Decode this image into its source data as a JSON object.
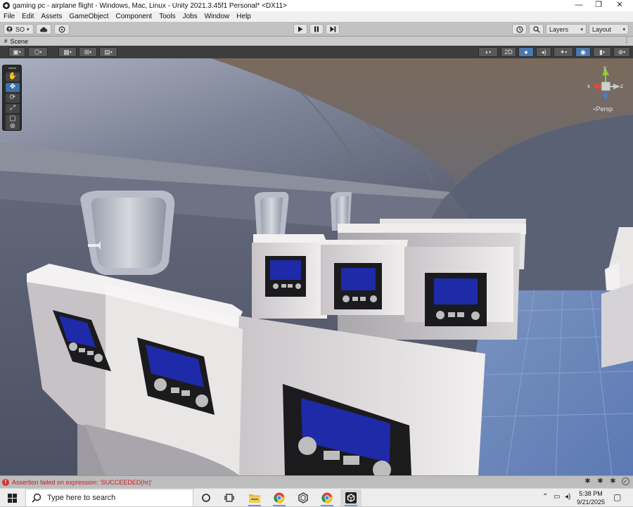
{
  "window": {
    "title": "gaming pc - airplane flight - Windows, Mac, Linux - Unity 2021.3.45f1 Personal* <DX11>",
    "controls": {
      "minimize": "—",
      "maximize": "❐",
      "close": "✕"
    }
  },
  "menu": [
    "File",
    "Edit",
    "Assets",
    "GameObject",
    "Component",
    "Tools",
    "Jobs",
    "Window",
    "Help"
  ],
  "toolbar": {
    "account_label": "SO",
    "account_icon": "account-icon",
    "cloud_icon": "cloud-icon",
    "collab_icon": "collab-icon",
    "play_icon": "play-icon",
    "pause_icon": "pause-icon",
    "step_icon": "step-icon",
    "history_icon": "history-icon",
    "search_icon": "search-icon",
    "layers_label": "Layers",
    "layout_label": "Layout"
  },
  "scene_tab": {
    "label": "Scene"
  },
  "scene_toolbar": {
    "mode_2d_label": "2D"
  },
  "tools": [
    "hand-tool",
    "move-tool",
    "rotate-tool",
    "scale-tool",
    "rect-tool",
    "transform-tool"
  ],
  "gizmo": {
    "y_label": "y",
    "x_label": "x",
    "z_label": "z",
    "projection": "Persp"
  },
  "status": {
    "message": "Assertion failed on expression: 'SUCCEEDED(hr)'"
  },
  "taskbar": {
    "search_placeholder": "Type here to search",
    "time": "5:38 PM",
    "date": "9/21/2025"
  },
  "colors": {
    "error": "#c31f1f",
    "scene_floor": "#6f93c8",
    "screen_blue": "#1e2aa8",
    "accent": "#3a6fa8"
  }
}
